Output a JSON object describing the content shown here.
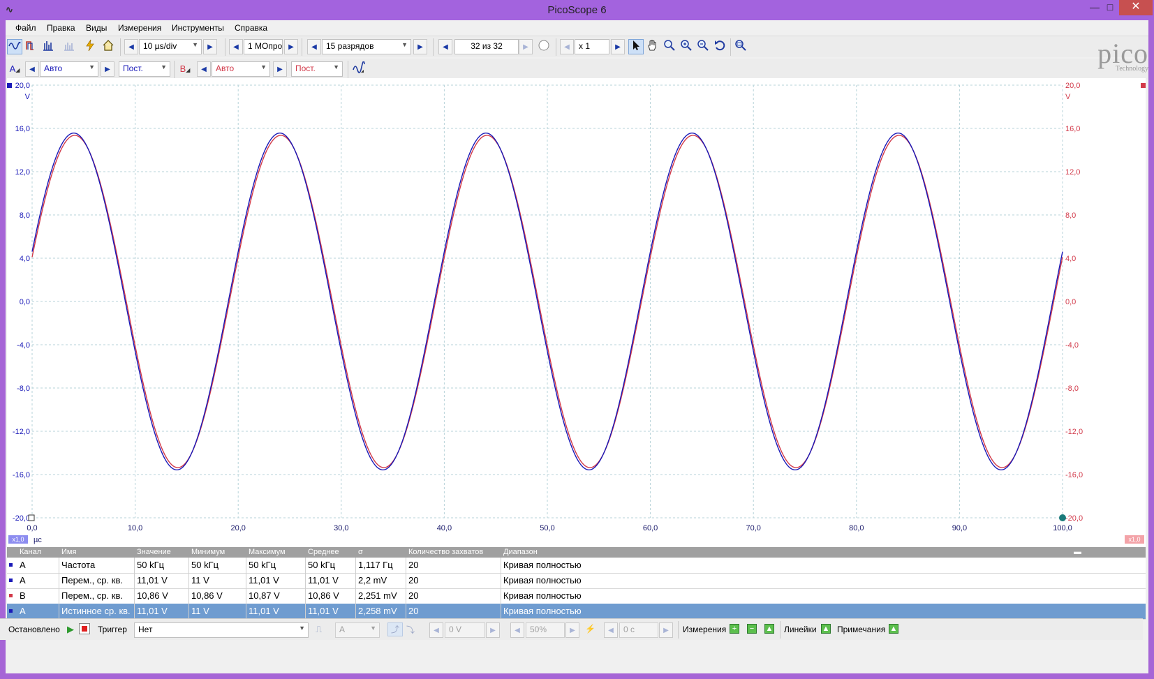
{
  "window": {
    "title": "PicoScope 6",
    "minimize": "—",
    "maximize": "□",
    "close": "✕"
  },
  "menu": [
    "Файл",
    "Правка",
    "Виды",
    "Измерения",
    "Инструменты",
    "Справка"
  ],
  "toolbar1": {
    "timebase": "10 µs/div",
    "samples": "1 МОпро",
    "resolution": "15 разрядов",
    "capture": "32 из 32",
    "zoom": "x 1"
  },
  "toolbar2": {
    "channel_a": {
      "label": "A",
      "range": "Авто",
      "coupling": "Пост."
    },
    "channel_b": {
      "label": "B",
      "range": "Авто",
      "coupling": "Пост."
    }
  },
  "logo": {
    "word": "pico",
    "sub": "Technology"
  },
  "colors": {
    "channel_a": "#1a1ab8",
    "channel_b": "#d23a4a",
    "grid": "#b7d3d9",
    "selected_row": "#6f9cd0"
  },
  "chart_data": {
    "type": "line",
    "x_unit": "µс",
    "y_unit_left": "V",
    "y_unit_right": "V",
    "xlim": [
      0,
      100
    ],
    "ylim": [
      -20,
      20
    ],
    "x_ticks": [
      "0,0",
      "10,0",
      "20,0",
      "30,0",
      "40,0",
      "50,0",
      "60,0",
      "70,0",
      "80,0",
      "90,0",
      "100,0"
    ],
    "y_ticks": [
      "20,0",
      "16,0",
      "12,0",
      "8,0",
      "4,0",
      "0,0",
      "-4,0",
      "-8,0",
      "-12,0",
      "-16,0",
      "-20,0"
    ],
    "grid": true,
    "x_scale_label": "x1,0",
    "y_scale_label_right": "x1,0",
    "series": [
      {
        "name": "A",
        "frequency_khz": 50,
        "amplitude_v": 15.57,
        "phase_deg": 17.2
      },
      {
        "name": "B",
        "frequency_khz": 50,
        "amplitude_v": 15.36,
        "phase_deg": 15.5
      }
    ]
  },
  "measurements": {
    "headers": [
      "Канал",
      "Имя",
      "Значение",
      "Минимум",
      "Максимум",
      "Среднее",
      "σ",
      "Количество захватов",
      "Диапазон"
    ],
    "rows": [
      [
        "A",
        "Частота",
        "50 kГц",
        "50 kГц",
        "50 kГц",
        "50 kГц",
        "1,117 Гц",
        "20",
        "Кривая полностью"
      ],
      [
        "A",
        "Перем., ср. кв.",
        "11,01 V",
        "11 V",
        "11,01 V",
        "11,01 V",
        "2,2 mV",
        "20",
        "Кривая полностью"
      ],
      [
        "B",
        "Перем., ср. кв.",
        "10,86 V",
        "10,86 V",
        "10,87 V",
        "10,86 V",
        "2,251 mV",
        "20",
        "Кривая полностью"
      ],
      [
        "A",
        "Истинное ср. кв.",
        "11,01 V",
        "11 V",
        "11,01 V",
        "11,01 V",
        "2,258 mV",
        "20",
        "Кривая полностью"
      ]
    ]
  },
  "status": {
    "state": "Остановлено",
    "trigger_label": "Триггер",
    "trigger_mode": "Нет",
    "trigger_source": "A",
    "trigger_level": "0 V",
    "pretrigger": "50%",
    "delay": "0 с",
    "measurements_label": "Измерения",
    "rulers_label": "Линейки",
    "notes_label": "Примечания"
  }
}
